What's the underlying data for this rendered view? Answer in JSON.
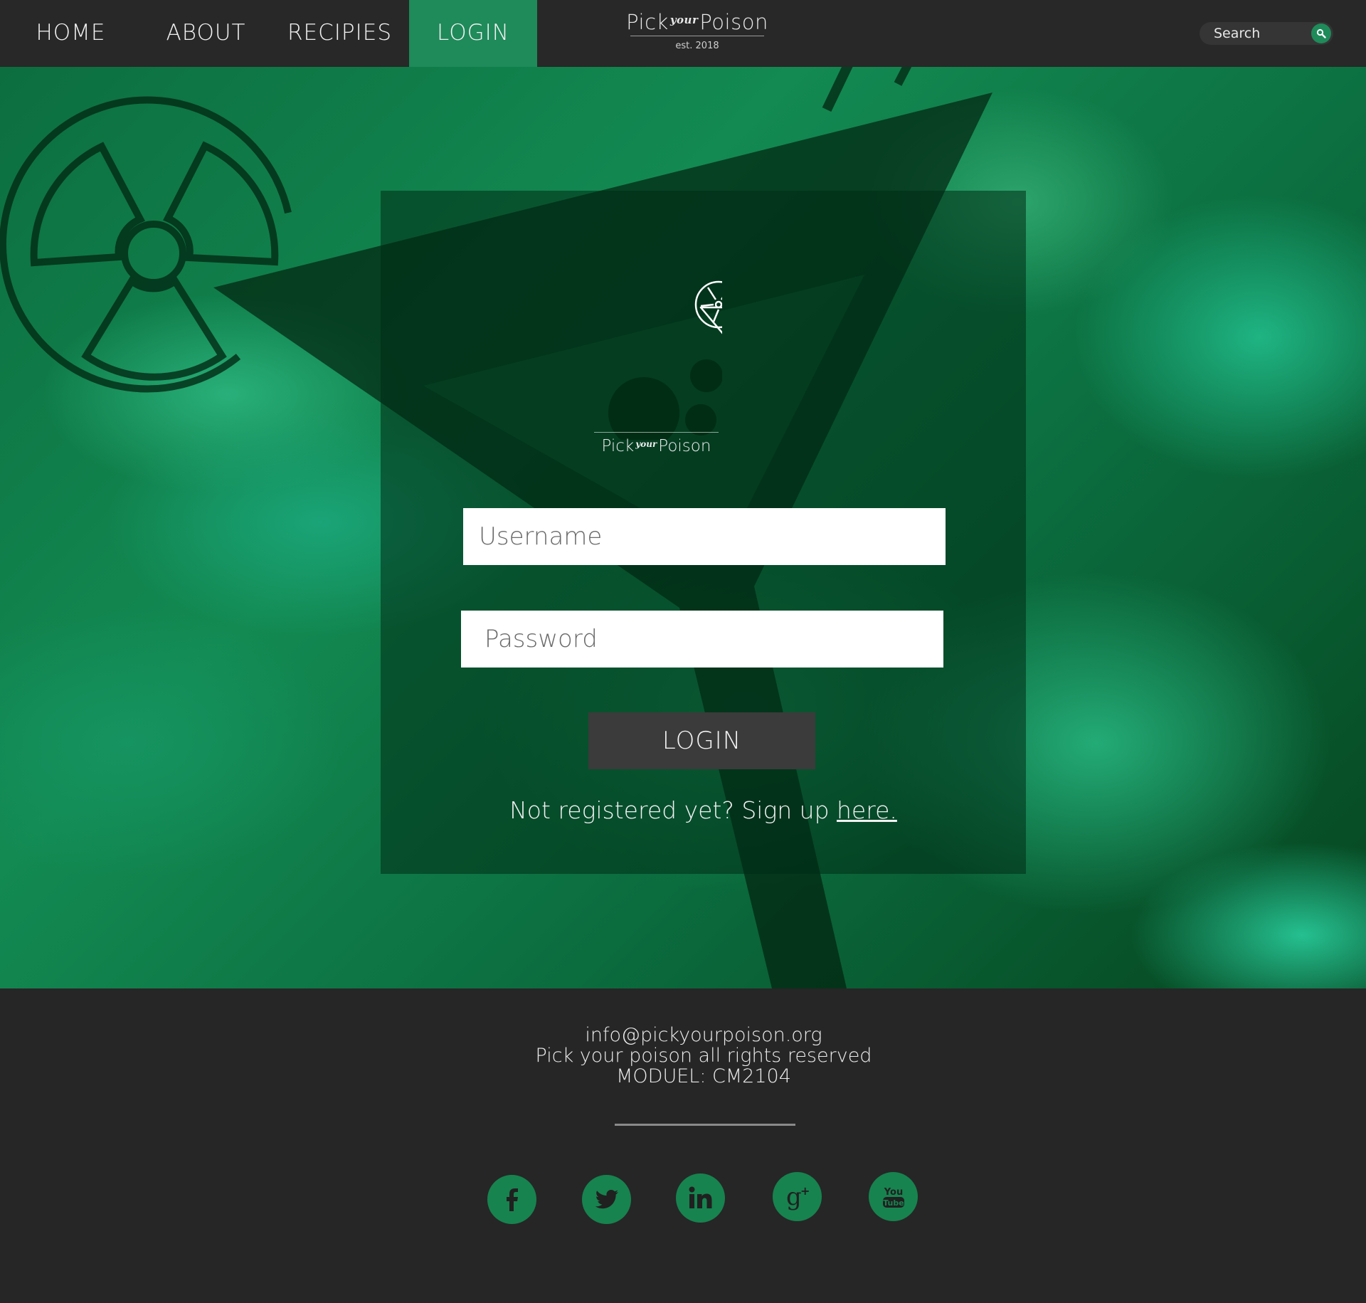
{
  "nav": {
    "items": [
      {
        "label": "HOME",
        "active": false
      },
      {
        "label": "ABOUT",
        "active": false
      },
      {
        "label": "RECIPIES",
        "active": false
      },
      {
        "label": "LOGIN",
        "active": true
      }
    ],
    "brand": {
      "pick": "Pick",
      "your": "your",
      "poison": "Poison",
      "est": "est. 2018"
    },
    "search": {
      "placeholder": "Search"
    }
  },
  "login": {
    "brand": {
      "pick": "Pick",
      "your": "your",
      "poison": "Poison"
    },
    "username_placeholder": "Username",
    "password_placeholder": "Password",
    "button_label": "LOGIN",
    "signup_prefix": "Not registered yet? Sign up ",
    "signup_link": "here."
  },
  "footer": {
    "email": "info@pickyourpoison.org",
    "rights": "Pick your poison all rights reserved",
    "module": "MODUEL: CM2104",
    "social": [
      "facebook-icon",
      "twitter-icon",
      "linkedin-icon",
      "google-plus-icon",
      "youtube-icon"
    ]
  },
  "colors": {
    "accent": "#1f8a5a",
    "nav_bg": "#282828",
    "footer_bg": "#262626",
    "button_bg": "#3b3b3b"
  }
}
